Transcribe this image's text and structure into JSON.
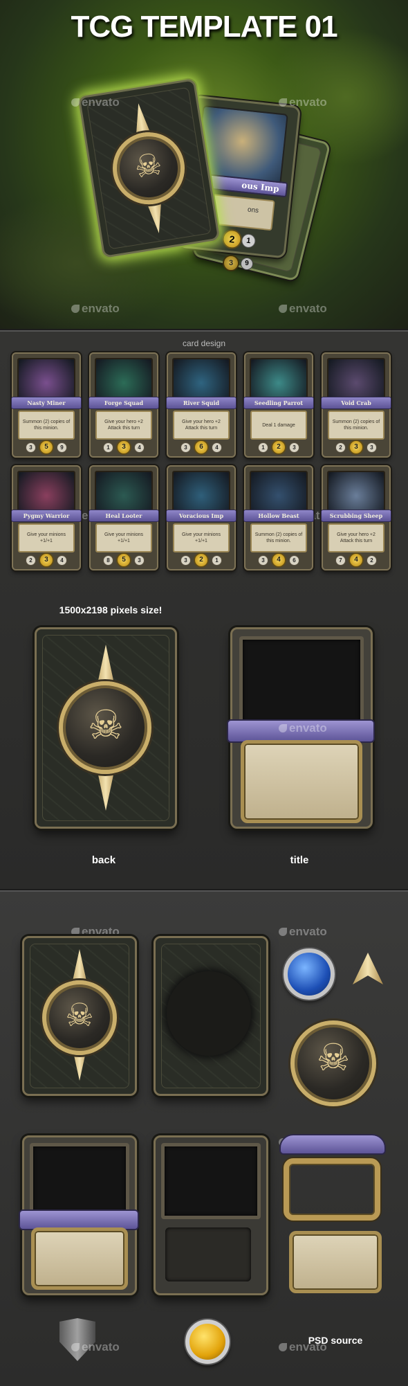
{
  "hero": {
    "title": "TCG TEMPLATE 01",
    "watermark": "envato",
    "front_card": {
      "name_fragment": "ous Imp",
      "body_fragment": "ons",
      "cost": "2",
      "stat": "1"
    },
    "back_card": {
      "cost": "3",
      "stat": "9"
    }
  },
  "design": {
    "heading": "card design",
    "size_note": "1500x2198 pixels size!",
    "back_caption": "back",
    "title_caption": "title",
    "cards": [
      {
        "name": "Nasty Miner",
        "text": "Summon (2) copies of this minion.",
        "left": "3",
        "cost": "5",
        "right": "9",
        "art": "#7a4f8e"
      },
      {
        "name": "Forge Squad",
        "text": "Give your hero +2 Attack this turn",
        "left": "1",
        "cost": "3",
        "right": "4",
        "art": "#2c6c57"
      },
      {
        "name": "River Squid",
        "text": "Give your hero +2 Attack this turn",
        "left": "3",
        "cost": "6",
        "right": "4",
        "art": "#2f6480"
      },
      {
        "name": "Seedling Parrot",
        "text": "Deal 1 damage",
        "left": "1",
        "cost": "2",
        "right": "3",
        "art": "#3d8a88"
      },
      {
        "name": "Void Crab",
        "text": "Summon (2) copies of this minion.",
        "left": "2",
        "cost": "3",
        "right": "3",
        "art": "#5b4a6e"
      },
      {
        "name": "Pygmy Warrior",
        "text": "Give your minions +1/+1",
        "left": "2",
        "cost": "3",
        "right": "4",
        "art": "#8a3f5e"
      },
      {
        "name": "Heal Looter",
        "text": "Give your minions +1/+1",
        "left": "8",
        "cost": "5",
        "right": "3",
        "art": "#2c5a52"
      },
      {
        "name": "Voracious Imp",
        "text": "Give your minions +1/+1",
        "left": "3",
        "cost": "2",
        "right": "1",
        "art": "#2f5f7a"
      },
      {
        "name": "Hollow Beast",
        "text": "Summon (2) copies of this minion.",
        "left": "3",
        "cost": "4",
        "right": "6",
        "art": "#34506e"
      },
      {
        "name": "Scrubbing Sheep",
        "text": "Give your hero +2 Attack this turn",
        "left": "7",
        "cost": "4",
        "right": "2",
        "art": "#6a7e9a"
      }
    ]
  },
  "psd": {
    "caption": "PSD source",
    "watermark": "envato"
  },
  "colors": {
    "gold": "#c9ae6a",
    "ribbon": "#7e74b9",
    "parchment": "#d8cfb4",
    "hero_green": "#6d8a2a"
  }
}
